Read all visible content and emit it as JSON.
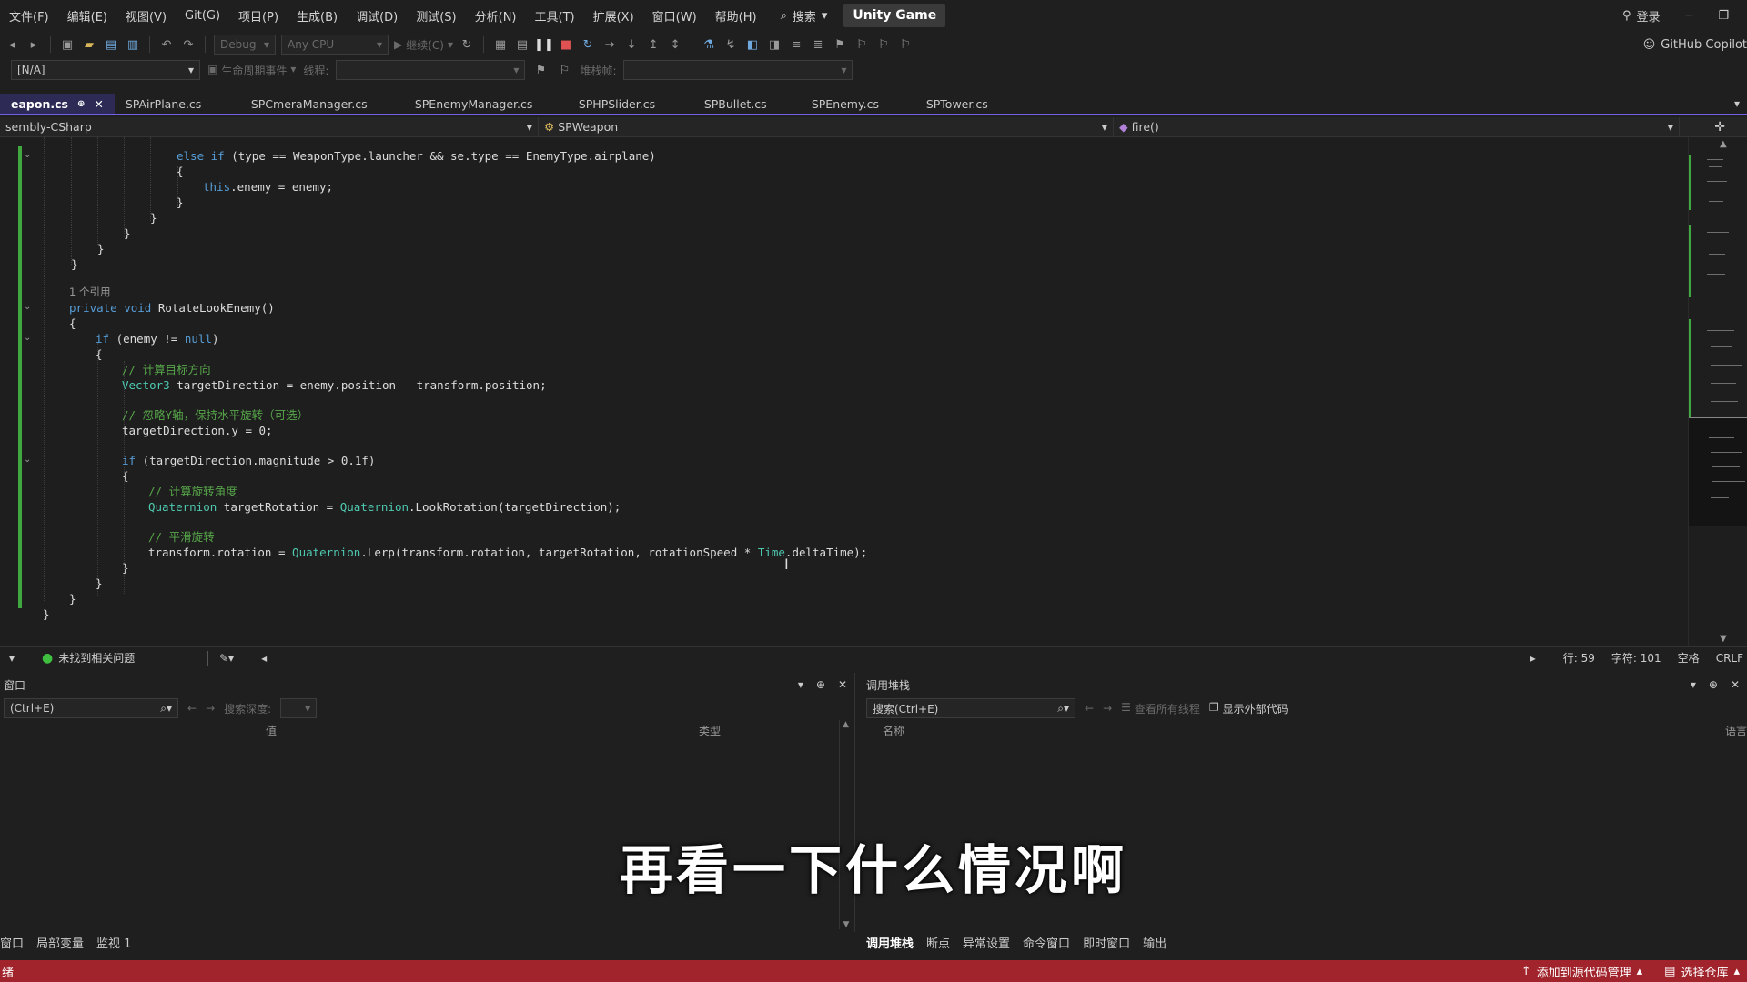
{
  "menu": {
    "items": [
      "文件(F)",
      "编辑(E)",
      "视图(V)",
      "Git(G)",
      "项目(P)",
      "生成(B)",
      "调试(D)",
      "测试(S)",
      "分析(N)",
      "工具(T)",
      "扩展(X)",
      "窗口(W)",
      "帮助(H)"
    ],
    "search_label": "搜索",
    "app_title": "Unity Game",
    "login": "登录"
  },
  "toolbar": {
    "config": "Debug",
    "platform": "Any CPU",
    "continue_label": "继续(C)",
    "copilot": "GitHub Copilot"
  },
  "toolbar2": {
    "process": "[N/A]",
    "lifecycle": "生命周期事件",
    "thread_label": "线程:",
    "stack_label": "堆栈帧:"
  },
  "tabs": [
    {
      "label": "eapon.cs",
      "active": true
    },
    {
      "label": "SPAirPlane.cs"
    },
    {
      "label": "SPCmeraManager.cs"
    },
    {
      "label": "SPEnemyManager.cs"
    },
    {
      "label": "SPHPSlider.cs"
    },
    {
      "label": "SPBullet.cs"
    },
    {
      "label": "SPEnemy.cs"
    },
    {
      "label": "SPTower.cs"
    }
  ],
  "navbar": {
    "project": "sembly-CSharp",
    "class": "SPWeapon",
    "member": "fire()"
  },
  "code": {
    "l1_else": "else if",
    "l1_rest": " (type == WeaponType.launcher && se.type == EnemyType.airplane)",
    "l2": "{",
    "l3_this": "this",
    "l3_rest": ".enemy = enemy;",
    "l4": "}",
    "l5": "}",
    "l6": "}",
    "l7": "}",
    "ref_count": "1 个引用",
    "l8_private": "private void",
    "l8_rest": " RotateLookEnemy()",
    "l9": "{",
    "l10_if": "if",
    "l10_mid": " (enemy != ",
    "l10_null": "null",
    "l10_end": ")",
    "l11": "{",
    "c1": "// 计算目标方向",
    "l12_type": "Vector3",
    "l12_rest": " targetDirection = enemy.position - transform.position;",
    "c2": "// 忽略Y轴，保持水平旋转（可选）",
    "l13": "targetDirection.y = 0;",
    "l14_if": "if",
    "l14_rest": " (targetDirection.magnitude > 0.1f)",
    "l15": "{",
    "c3": "// 计算旋转角度",
    "l16_type": "Quaternion",
    "l16_mid": " targetRotation = ",
    "l16_type2": "Quaternion",
    "l16_rest": ".LookRotation(targetDirection);",
    "c4": "// 平滑旋转",
    "l17_a": "transform.rotation = ",
    "l17_type": "Quaternion",
    "l17_b": ".Lerp(transform.rotation, targetRotation, rotationSpeed * ",
    "l17_time": "Time",
    "l17_c": ".deltaTime);",
    "l18": "}",
    "l19": "}",
    "l20": "}",
    "l21": "}"
  },
  "editor_status": {
    "issues": "未找到相关问题",
    "line": "行: 59",
    "char": "字符: 101",
    "spaces": "空格",
    "eol": "CRLF"
  },
  "panel_left": {
    "title": "窗口",
    "search_placeholder": "(Ctrl+E)",
    "depth_label": "搜索深度:",
    "col_value": "值",
    "col_type": "类型",
    "tabs": [
      "窗口",
      "局部变量",
      "监视 1"
    ]
  },
  "panel_right": {
    "title": "调用堆栈",
    "search_placeholder": "搜索(Ctrl+E)",
    "view_threads": "查看所有线程",
    "show_external": "显示外部代码",
    "col_name": "名称",
    "col_lang": "语言",
    "tabs": [
      "调用堆栈",
      "断点",
      "异常设置",
      "命令窗口",
      "即时窗口",
      "输出"
    ]
  },
  "subtitle": "再看一下什么情况啊",
  "statusbar": {
    "left": "绪",
    "source_control": "添加到源代码管理",
    "repo": "选择仓库"
  }
}
